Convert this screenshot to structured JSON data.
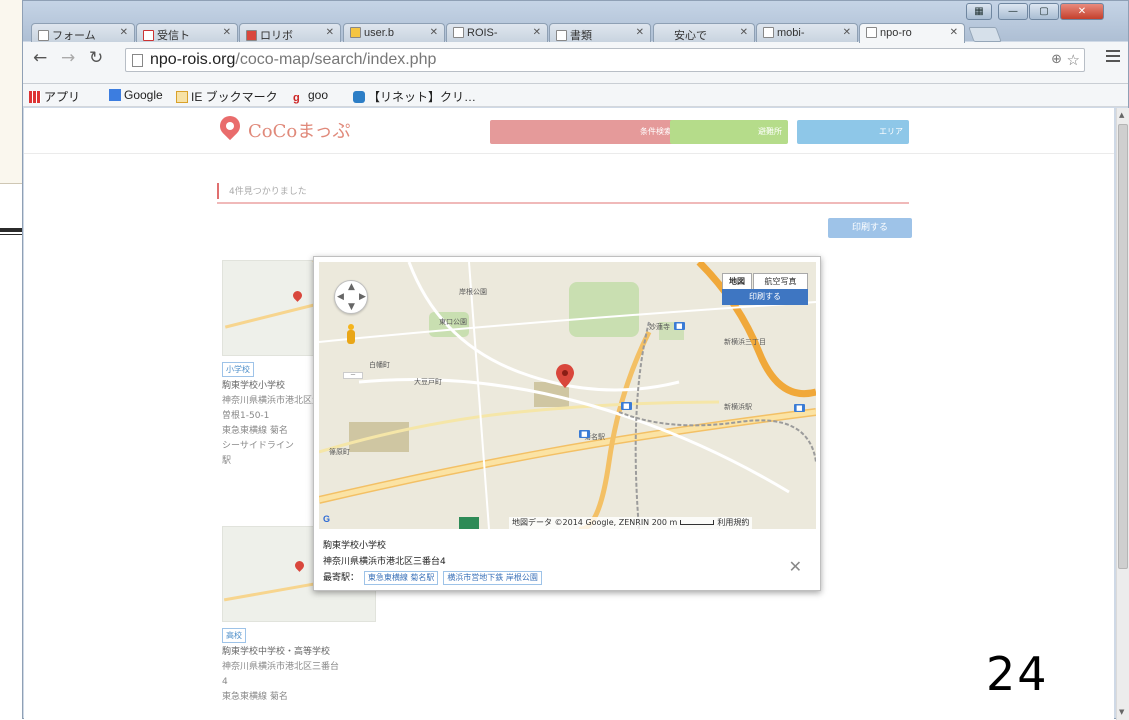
{
  "browser": {
    "tabs": [
      {
        "label": "フォーム"
      },
      {
        "label": "受信ト"
      },
      {
        "label": "ロリボ"
      },
      {
        "label": "user.b"
      },
      {
        "label": "ROIS-"
      },
      {
        "label": "書類"
      },
      {
        "label": "安心で"
      },
      {
        "label": "mobi-"
      },
      {
        "label": "npo-ro"
      }
    ],
    "url_host": "npo-rois.org",
    "url_path": "/coco-map/search/index.php",
    "bookmarks": [
      "アプリ",
      "Google",
      "IE ブックマーク",
      "goo",
      "【リネット】クリ…"
    ]
  },
  "site": {
    "logo": "CoCoまっぷ",
    "nav": [
      "条件検索",
      "避難所",
      "エリア"
    ],
    "search_text": "4件見つかりました",
    "primary_button": "印刷する"
  },
  "cards": [
    {
      "tag": "小学校",
      "name": "駒東学校小学校",
      "lines": [
        "神奈川県横浜市港北区大",
        "曽根1-50-1",
        "東急東横線 菊名",
        "シーサイドライン",
        "駅"
      ]
    },
    {
      "tag": "高校",
      "name": "駒東学校中学校・高等学校",
      "lines": [
        "神奈川県横浜市港北区三番台",
        "4",
        "東急東横線 菊名"
      ]
    }
  ],
  "dialog": {
    "map_types": [
      "地図",
      "航空写真"
    ],
    "map_dropdown": "印刷する",
    "attribution": "地図データ ©2014 Google, ZENRIN",
    "scale": "200 m",
    "terms": "利用規約",
    "title": "駒東学校小学校",
    "address": "神奈川県横浜市港北区三番台4",
    "station_label": "最寄駅：",
    "stations": [
      "東急東横線 菊名駅",
      "横浜市営地下鉄 岸根公園"
    ]
  },
  "map_labels": [
    "岸根公園",
    "東口公園",
    "菊名駅",
    "新横浜駅",
    "妙蓮寺",
    "大豆戸町",
    "篠原町",
    "新横浜三丁目",
    "白幡町"
  ],
  "page_number": "24",
  "colors": {
    "accent": "#e06f6f",
    "button": "#9ec3e8",
    "link": "#3b72b9",
    "map_blue": "#3e76c2"
  }
}
